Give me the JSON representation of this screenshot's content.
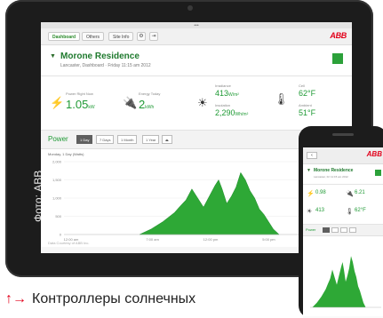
{
  "photo_credit": "Фото: ABB",
  "caption": {
    "arrows": "↑→",
    "text": "Контроллеры солнечных"
  },
  "tablet_app": {
    "tabs": [
      "Dashboard",
      "Others",
      "Site Info"
    ],
    "logo": "ABB",
    "site": {
      "title": "Morone Residence",
      "subtitle": "Lancaster, Dashboard · Friday 11:15 am 2012"
    },
    "metrics": {
      "power_label": "Power Right Now",
      "power_value": "1.05",
      "power_unit": "kW",
      "energy_label": "Energy Today",
      "energy_value": "2",
      "energy_unit": "kWh",
      "irradiance_label": "Irradiance",
      "irradiance_value": "413",
      "irradiance_unit": "W/m²",
      "insolation_label": "Insolation",
      "insolation_value": "2,290",
      "insolation_unit": "Wh/m²",
      "cell_label": "Cell",
      "cell_value": "62°F",
      "ambient_label": "Ambient",
      "ambient_value": "51°F"
    },
    "power_range": {
      "label": "Power",
      "buttons": [
        "1 Day",
        "7 Days",
        "1 Month",
        "1 Year"
      ]
    },
    "chart": {
      "heading": "Monday, 1 Day (Watts)",
      "footer": "Data Courtesy of ABB Inc."
    }
  },
  "phone_app": {
    "logo": "ABB",
    "site_title": "Morone Residence",
    "site_sub": "Lancaster, Fri 11:15 am 2012",
    "power_value": "0.98",
    "energy_value": "6.21",
    "irr_value": "413",
    "temp_value": "62°F",
    "range_label": "Power"
  },
  "chart_data": {
    "type": "area",
    "y_ticks": [
      "2,000",
      "1,500",
      "1,000",
      "500",
      "0"
    ],
    "x_ticks": [
      "12:00 am",
      "7:00 am",
      "12:00 pm",
      "5:00 pm"
    ],
    "ylim": [
      0,
      2000
    ],
    "x": [
      6.5,
      7.5,
      8.5,
      9.5,
      10.0,
      10.5,
      11.0,
      11.5,
      12.0,
      12.5,
      13.0,
      13.3,
      13.6,
      14.0,
      14.4,
      14.8,
      15.2,
      15.6,
      16.0,
      16.4,
      16.8,
      17.2,
      17.6,
      18.0,
      18.5
    ],
    "values": [
      0,
      150,
      350,
      600,
      780,
      950,
      1250,
      1000,
      750,
      1050,
      1350,
      1500,
      1250,
      850,
      1050,
      1300,
      1700,
      1500,
      1200,
      1000,
      700,
      550,
      350,
      150,
      0
    ],
    "color": "#2ea836"
  }
}
